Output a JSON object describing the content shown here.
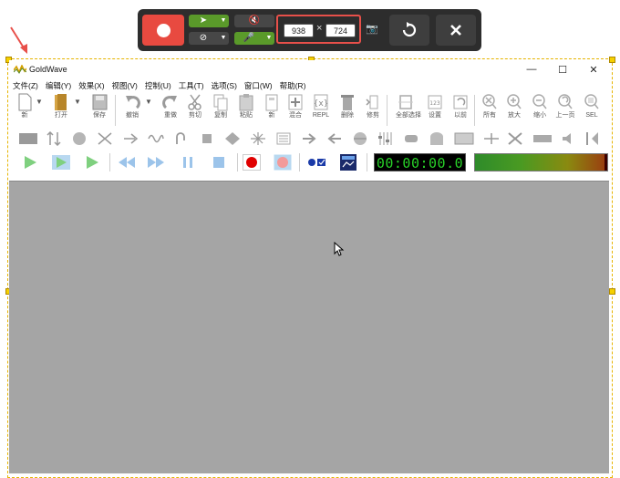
{
  "recorder": {
    "width_value": "938",
    "height_value": "724",
    "times_symbol": "×",
    "colors": {
      "bar": "#2d2d2d",
      "record": "#e84a40",
      "green": "#5a9a2a",
      "highlight": "#e8504a"
    }
  },
  "window": {
    "title": "GoldWave",
    "controls": {
      "minimize": "—",
      "maximize": "☐",
      "close": "✕"
    }
  },
  "menu": [
    "文件(Z)",
    "编辑(Y)",
    "效果(X)",
    "视图(V)",
    "控制(U)",
    "工具(T)",
    "选项(S)",
    "窗口(W)",
    "帮助(R)"
  ],
  "toolbar1": {
    "new": "新",
    "open": "打开",
    "save": "保存",
    "undo": "撤销",
    "redo": "重做",
    "cut": "剪切",
    "copy": "复制",
    "paste": "粘贴",
    "paste_new": "新",
    "mix": "混合",
    "replace": "REPL",
    "delete": "删除",
    "trim": "修剪",
    "select_all": "全部选择",
    "set": "设置",
    "previous": "以前",
    "all": "所有",
    "zoom_in": "放大",
    "zoom_out": "缩小",
    "prev_page": "上一页",
    "sel": "SEL"
  },
  "transport": {
    "timer": "00:00:00.0"
  }
}
